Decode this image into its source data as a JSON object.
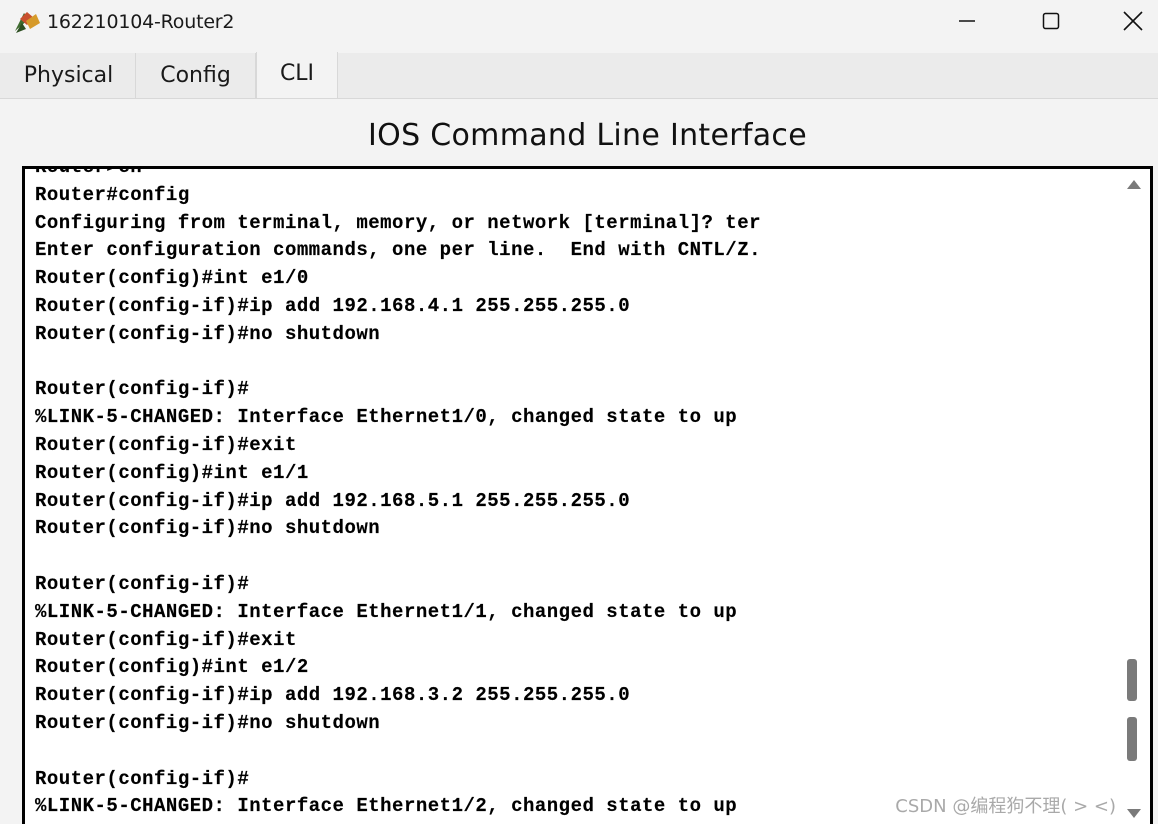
{
  "window": {
    "title": "162210104-Router2",
    "icon": "router-app-icon",
    "controls": {
      "minimize": "minimize-icon",
      "maximize": "maximize-icon",
      "close": "close-icon"
    }
  },
  "tabs": [
    {
      "label": "Physical",
      "active": false
    },
    {
      "label": "Config",
      "active": false
    },
    {
      "label": "CLI",
      "active": true
    }
  ],
  "cli": {
    "heading": "IOS Command Line Interface",
    "lines": [
      "Router>en",
      "Router#config",
      "Configuring from terminal, memory, or network [terminal]? ter",
      "Enter configuration commands, one per line.  End with CNTL/Z.",
      "Router(config)#int e1/0",
      "Router(config-if)#ip add 192.168.4.1 255.255.255.0",
      "Router(config-if)#no shutdown",
      "",
      "Router(config-if)#",
      "%LINK-5-CHANGED: Interface Ethernet1/0, changed state to up",
      "Router(config-if)#exit",
      "Router(config)#int e1/1",
      "Router(config-if)#ip add 192.168.5.1 255.255.255.0",
      "Router(config-if)#no shutdown",
      "",
      "Router(config-if)#",
      "%LINK-5-CHANGED: Interface Ethernet1/1, changed state to up",
      "Router(config-if)#exit",
      "Router(config)#int e1/2",
      "Router(config-if)#ip add 192.168.3.2 255.255.255.0",
      "Router(config-if)#no shutdown",
      "",
      "Router(config-if)#",
      "%LINK-5-CHANGED: Interface Ethernet1/2, changed state to up"
    ]
  },
  "watermark": "CSDN @编程狗不理( > <)",
  "colors": {
    "chrome_bg": "#f3f3f3",
    "tab_bg": "#ebebeb",
    "terminal_bg": "#ffffff",
    "terminal_border": "#000000",
    "terminal_text": "#000000",
    "scrollbar_thumb": "#7a7a7a"
  }
}
